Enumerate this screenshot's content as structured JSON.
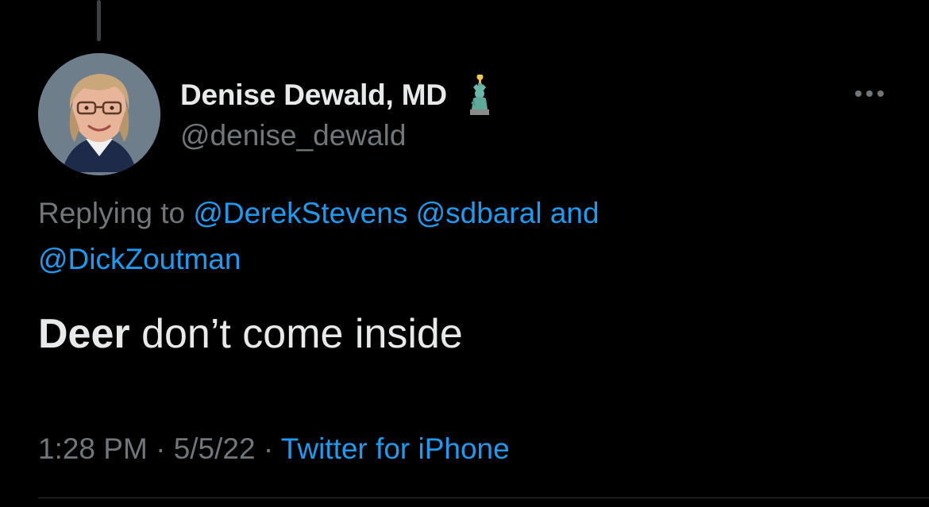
{
  "tweet": {
    "author": {
      "display_name": "Denise Dewald, MD",
      "handle": "@denise_dewald",
      "flair_icon": "statue-of-liberty-emoji"
    },
    "reply_context": {
      "prefix": "Replying to",
      "mentions": [
        "@DerekStevens",
        "@sdbaral",
        "@DickZoutman"
      ],
      "conjunction": "and"
    },
    "text": {
      "bold_part": "Deer",
      "rest": " don’t come inside"
    },
    "meta": {
      "time": "1:28 PM",
      "separator": "·",
      "date": "5/5/22",
      "source": "Twitter for iPhone"
    },
    "more_icon": "ellipsis-horizontal-icon"
  },
  "colors": {
    "background": "#000000",
    "primary_text": "#e7e9ea",
    "secondary_text": "#71767b",
    "link": "#1d9bf0",
    "divider": "#2f3336"
  }
}
